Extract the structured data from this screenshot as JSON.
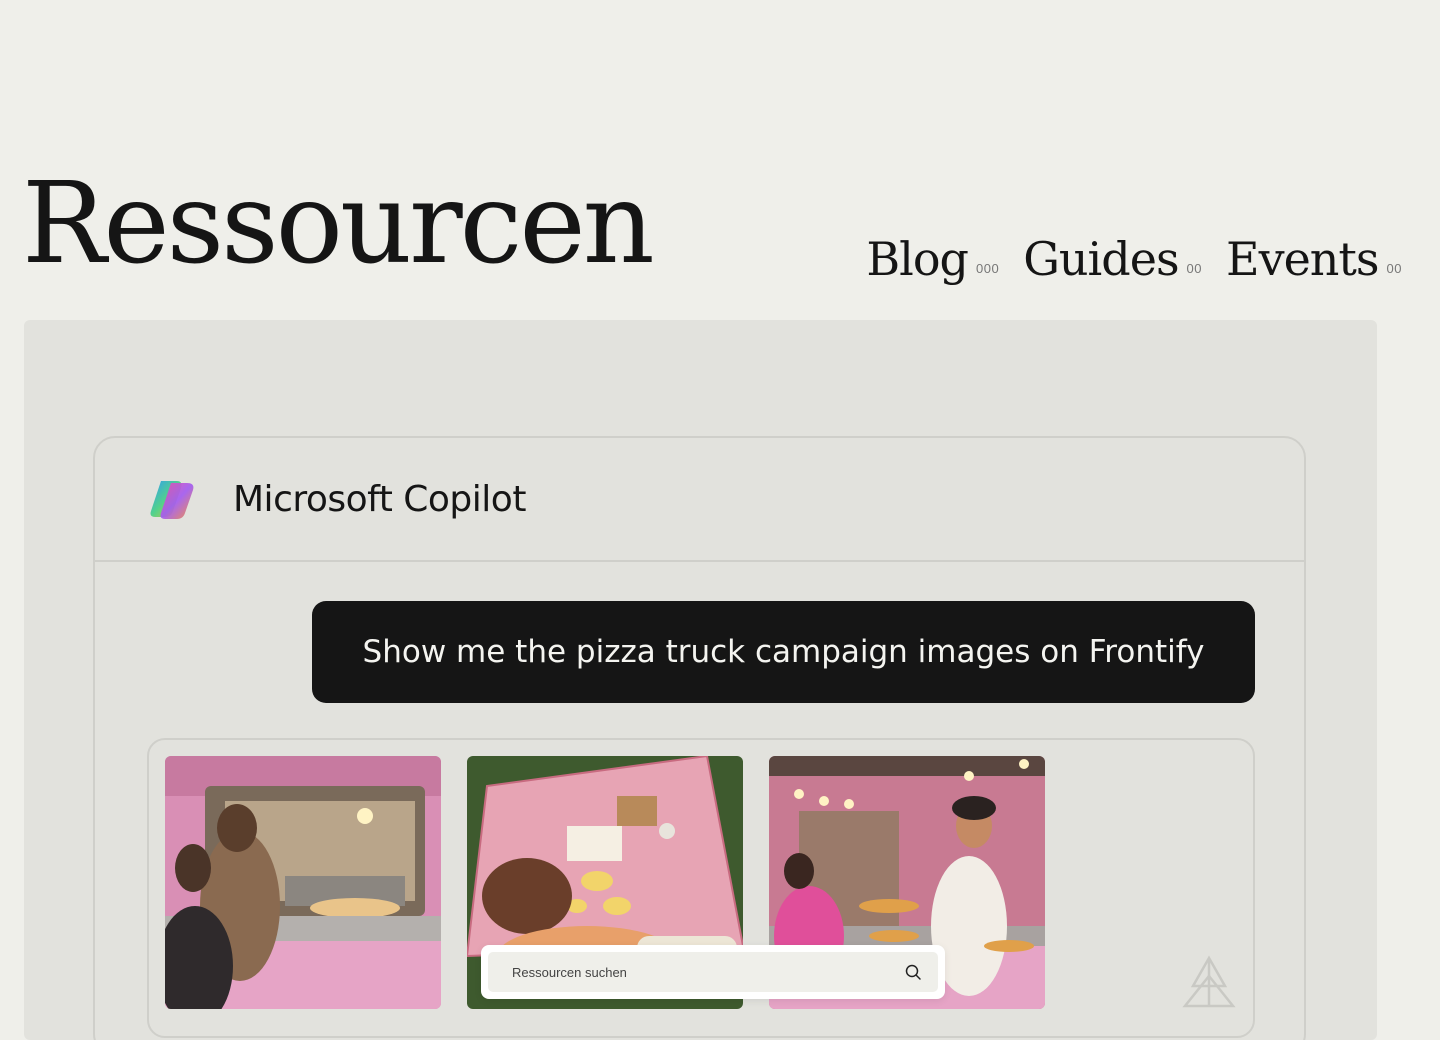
{
  "page": {
    "title": "Ressourcen"
  },
  "nav": {
    "items": [
      {
        "label": "Blog",
        "count": "000"
      },
      {
        "label": "Guides",
        "count": "00"
      },
      {
        "label": "Events",
        "count": "00"
      }
    ]
  },
  "copilot": {
    "title": "Microsoft Copilot",
    "logo_icon": "copilot-logo-icon",
    "prompt": "Show me the pizza truck campaign images on Frontify",
    "results": [
      {
        "icon": "pizza-truck-photo"
      },
      {
        "icon": "picnic-photo"
      },
      {
        "icon": "pizza-chef-photo"
      }
    ],
    "brand_icon": "frontify-logo-icon"
  },
  "search": {
    "placeholder": "Ressourcen suchen",
    "value": "",
    "icon": "search-icon"
  },
  "colors": {
    "background": "#efefea",
    "panel": "#e2e2dd",
    "bubble": "#151515",
    "border": "#cfcfca",
    "accent_pink": "#e59ac0"
  }
}
